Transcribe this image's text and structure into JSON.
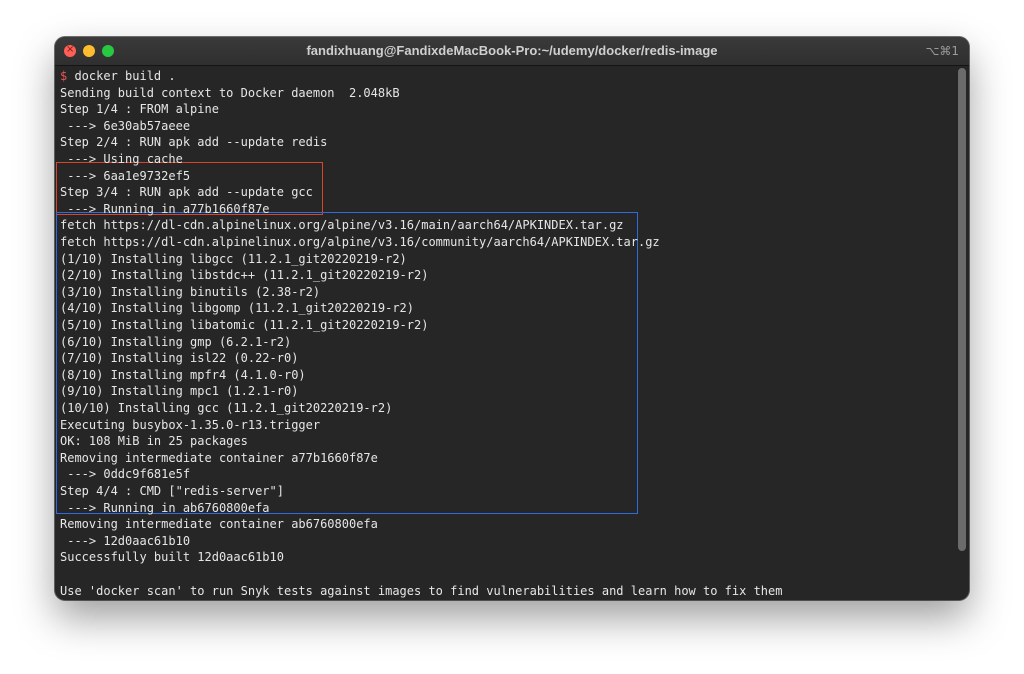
{
  "window": {
    "title": "fandixhuang@FandixdeMacBook-Pro:~/udemy/docker/redis-image",
    "shortcut": "⌥⌘1",
    "close_glyph": "×"
  },
  "terminal": {
    "prompt_symbol": "$",
    "command": " docker build .",
    "lines": [
      "Sending build context to Docker daemon  2.048kB",
      "Step 1/4 : FROM alpine",
      " ---> 6e30ab57aeee",
      "Step 2/4 : RUN apk add --update redis",
      " ---> Using cache",
      " ---> 6aa1e9732ef5",
      "Step 3/4 : RUN apk add --update gcc",
      " ---> Running in a77b1660f87e",
      "fetch https://dl-cdn.alpinelinux.org/alpine/v3.16/main/aarch64/APKINDEX.tar.gz",
      "fetch https://dl-cdn.alpinelinux.org/alpine/v3.16/community/aarch64/APKINDEX.tar.gz",
      "(1/10) Installing libgcc (11.2.1_git20220219-r2)",
      "(2/10) Installing libstdc++ (11.2.1_git20220219-r2)",
      "(3/10) Installing binutils (2.38-r2)",
      "(4/10) Installing libgomp (11.2.1_git20220219-r2)",
      "(5/10) Installing libatomic (11.2.1_git20220219-r2)",
      "(6/10) Installing gmp (6.2.1-r2)",
      "(7/10) Installing isl22 (0.22-r0)",
      "(8/10) Installing mpfr4 (4.1.0-r0)",
      "(9/10) Installing mpc1 (1.2.1-r0)",
      "(10/10) Installing gcc (11.2.1_git20220219-r2)",
      "Executing busybox-1.35.0-r13.trigger",
      "OK: 108 MiB in 25 packages",
      "Removing intermediate container a77b1660f87e",
      " ---> 0ddc9f681e5f",
      "Step 4/4 : CMD [\"redis-server\"]",
      " ---> Running in ab6760800efa",
      "Removing intermediate container ab6760800efa",
      " ---> 12d0aac61b10",
      "Successfully built 12d0aac61b10",
      "",
      "Use 'docker scan' to run Snyk tests against images to find vulnerabilities and learn how to fix them"
    ]
  },
  "colors": {
    "background": "#262626",
    "text": "#e6e6e6",
    "prompt": "#e8574f",
    "highlight_red": "#d9452a",
    "highlight_blue": "#2f6be0"
  }
}
